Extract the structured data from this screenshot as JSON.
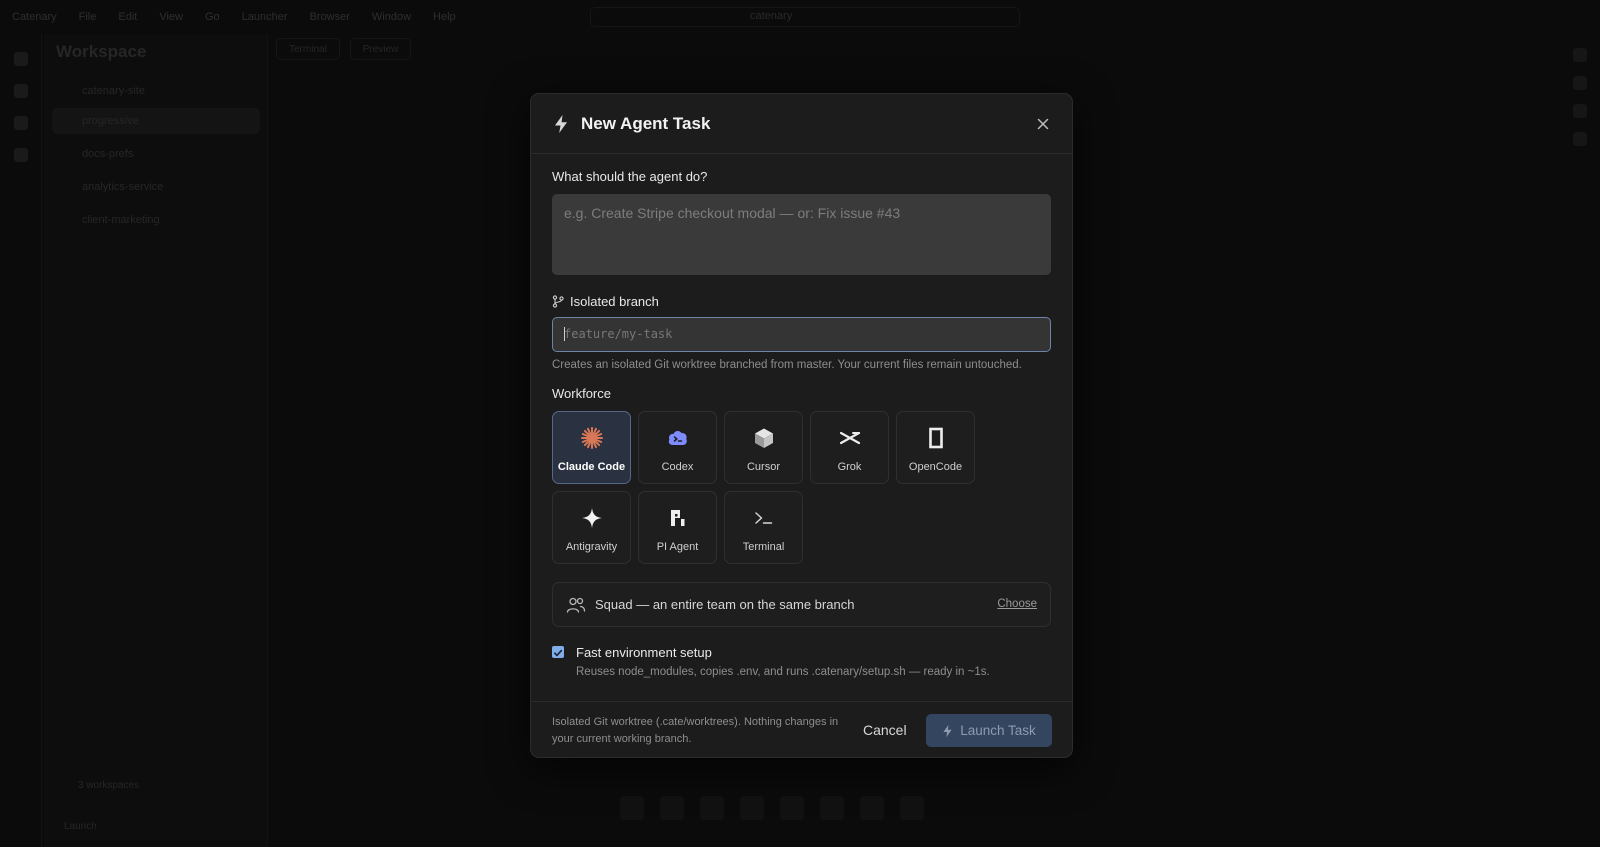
{
  "background": {
    "menu_items": [
      "Catenary",
      "File",
      "Edit",
      "View",
      "Go",
      "Launcher",
      "Browser",
      "Window",
      "Help"
    ],
    "window_title": "catenary",
    "workspace_title": "Workspace",
    "workspace_rows": [
      "catenary-site",
      "progressive",
      "docs-prefs",
      "analytics-service",
      "client-marketing"
    ],
    "tabs": [
      "Terminal",
      "Preview"
    ],
    "sidebar_footer": "3 workspaces",
    "sidebar_footer2": "Launch"
  },
  "modal": {
    "title": "New Agent Task",
    "icons": {
      "header": "lightning-icon",
      "close": "close-icon"
    }
  },
  "prompt": {
    "label": "What should the agent do?",
    "placeholder": "e.g. Create Stripe checkout modal — or: Fix issue #43"
  },
  "branch": {
    "label": "Isolated branch",
    "placeholder": "feature/my-task",
    "hint": "Creates an isolated Git worktree branched from master. Your current files remain untouched."
  },
  "workforce": {
    "label": "Workforce",
    "selected": "Claude Code",
    "agents": [
      {
        "label": "Claude Code",
        "icon": "claude-burst-icon"
      },
      {
        "label": "Codex",
        "icon": "codex-cloud-icon"
      },
      {
        "label": "Cursor",
        "icon": "cursor-cube-icon"
      },
      {
        "label": "Grok",
        "icon": "grok-x-icon"
      },
      {
        "label": "OpenCode",
        "icon": "opencode-icon"
      },
      {
        "label": "Antigravity",
        "icon": "sparkle-icon"
      },
      {
        "label": "PI Agent",
        "icon": "pi-icon"
      },
      {
        "label": "Terminal",
        "icon": "terminal-prompt-icon"
      }
    ],
    "colors": {
      "claude": "#d97757",
      "codex": "#7f8cff"
    }
  },
  "squad": {
    "text": "Squad — an entire team on the same branch",
    "action": "Choose",
    "icon": "users-icon"
  },
  "fast_setup": {
    "checked": true,
    "title": "Fast environment setup",
    "description": "Reuses node_modules, copies .env, and runs .catenary/setup.sh — ready in ~1s."
  },
  "footer": {
    "note": "Isolated Git worktree (.cate/worktrees). Nothing changes in your current working branch.",
    "cancel": "Cancel",
    "launch": "Launch Task"
  },
  "colors": {
    "accent": "#7faee8",
    "launch_bg": "#34455f",
    "selected_tile": "#2a3140"
  }
}
